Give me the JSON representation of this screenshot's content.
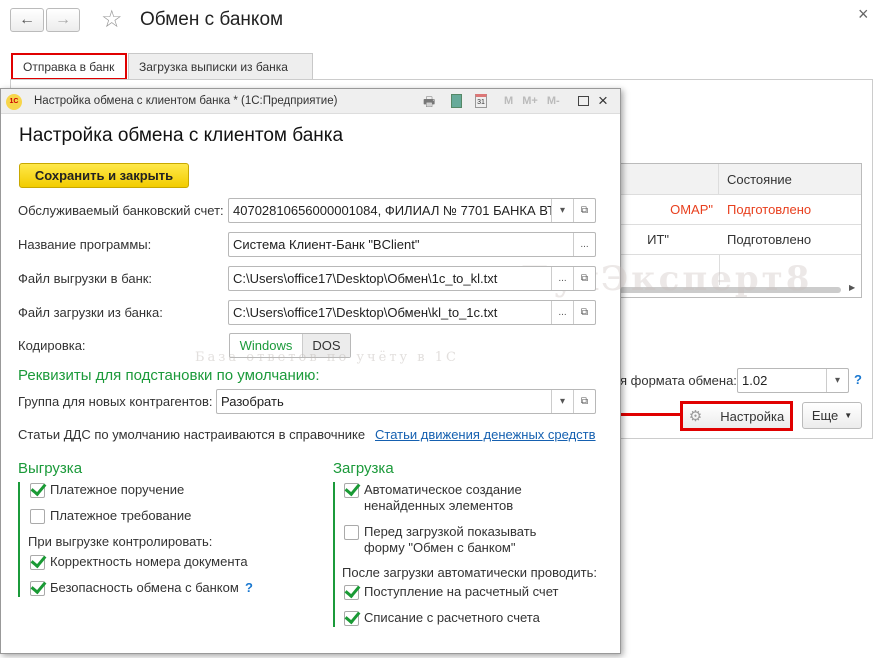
{
  "window": {
    "title": "Обмен с банком",
    "back": "←",
    "forward": "→",
    "star": "☆",
    "close": "×"
  },
  "tabs": [
    {
      "label": "Отправка в банк",
      "active": true
    },
    {
      "label": "Загрузка выписки из банка",
      "active": false
    }
  ],
  "table": {
    "header": [
      "",
      "Состояние"
    ],
    "rows": [
      {
        "name": "ОМАР\"",
        "status": "Подготовлено",
        "color": "#e8401f"
      },
      {
        "name": "ИТ\"",
        "status": "Подготовлено",
        "color": "#333333"
      }
    ]
  },
  "format": {
    "label": "я формата обмена:",
    "value": "1.02",
    "help": "?"
  },
  "buttons": {
    "settings": "Настройка",
    "more": "Еще"
  },
  "watermark": {
    "brand": "БухЭксперт8",
    "tagline": "База ответов по учёту в 1С"
  },
  "dialog": {
    "title": "Настройка обмена с клиентом банка * (1С:Предприятие)",
    "logo": "1С",
    "toolbar": [
      "M",
      "M+",
      "M-"
    ],
    "heading": "Настройка обмена с клиентом банка",
    "save_close": "Сохранить и закрыть",
    "fields": [
      {
        "label": "Обслуживаемый банковский счет:",
        "value": "40702810656000001084, ФИЛИАЛ № 7701 БАНКА ВТ"
      },
      {
        "label": "Название программы:",
        "value": "Система Клиент-Банк \"BClient\""
      },
      {
        "label": "Файл выгрузки в банк:",
        "value": "C:\\Users\\office17\\Desktop\\Обмен\\1c_to_kl.txt"
      },
      {
        "label": "Файл загрузки из банка:",
        "value": "C:\\Users\\office17\\Desktop\\Обмен\\kl_to_1c.txt"
      }
    ],
    "encoding": {
      "label": "Кодировка:",
      "options": [
        "Windows",
        "DOS"
      ],
      "selected": "Windows"
    },
    "defaults_title": "Реквизиты для подстановки по умолчанию:",
    "group": {
      "label": "Группа для новых контрагентов:",
      "value": "Разобрать"
    },
    "dds_text": "Статьи ДДС по умолчанию настраиваются в справочнике",
    "dds_link": "Статьи движения денежных средств",
    "export": {
      "title": "Выгрузка",
      "items": [
        {
          "label": "Платежное поручение",
          "checked": true
        },
        {
          "label": "Платежное требование",
          "checked": false
        }
      ],
      "control_title": "При выгрузке контролировать:",
      "control_items": [
        {
          "label": "Корректность номера документа",
          "checked": true
        },
        {
          "label": "Безопасность обмена с банком",
          "checked": true
        }
      ],
      "help": "?"
    },
    "import": {
      "title": "Загрузка",
      "items": [
        {
          "label": "Автоматическое создание",
          "label2": "ненайденных элементов",
          "checked": true
        },
        {
          "label": "Перед загрузкой показывать",
          "label2": "форму \"Обмен с банком\"",
          "checked": false
        }
      ],
      "post_title": "После загрузки автоматически проводить:",
      "post_items": [
        {
          "label": "Поступление на расчетный счет",
          "checked": true
        },
        {
          "label": "Списание с расчетного счета",
          "checked": true
        }
      ]
    }
  },
  "colors": {
    "accent_green": "#1b9a3a",
    "highlight_red": "#e00000",
    "save_yellow": "#f5d300",
    "link": "#1560b0"
  }
}
